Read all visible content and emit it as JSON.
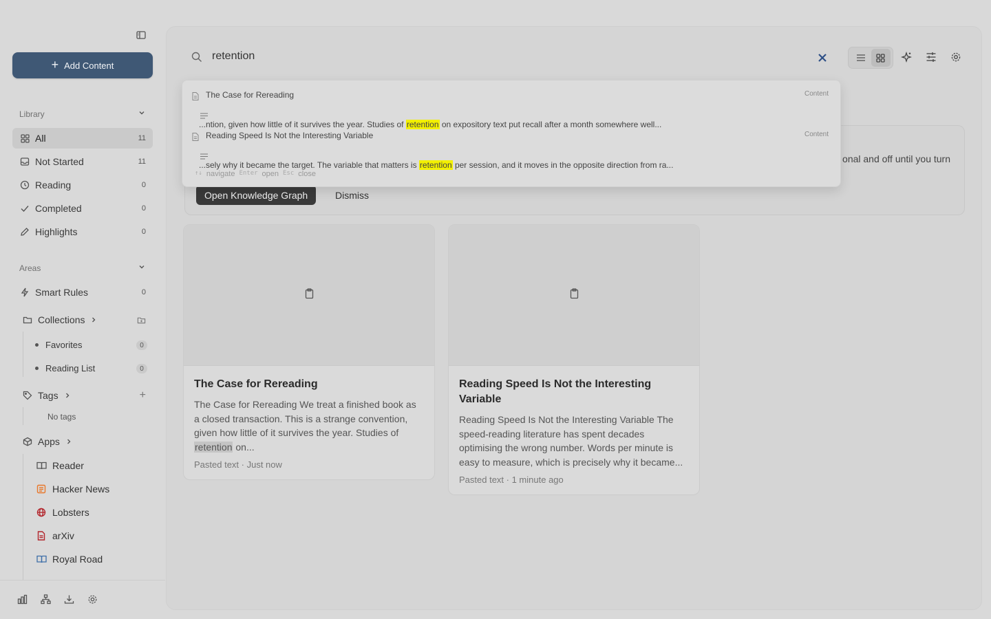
{
  "sidebar": {
    "add_label": "Add Content",
    "library_label": "Library",
    "library": [
      {
        "label": "All",
        "count": "11"
      },
      {
        "label": "Not Started",
        "count": "11"
      },
      {
        "label": "Reading",
        "count": "0"
      },
      {
        "label": "Completed",
        "count": "0"
      },
      {
        "label": "Highlights",
        "count": "0"
      }
    ],
    "areas_label": "Areas",
    "smart_rules": {
      "label": "Smart Rules",
      "count": "0"
    },
    "collections_label": "Collections",
    "collections": [
      {
        "label": "Favorites",
        "count": "0"
      },
      {
        "label": "Reading List",
        "count": "0"
      }
    ],
    "tags_label": "Tags",
    "no_tags": "No tags",
    "apps_label": "Apps",
    "apps": [
      {
        "label": "Reader",
        "icon": "book-icon",
        "color": "#555555"
      },
      {
        "label": "Hacker News",
        "icon": "hacker-news-icon",
        "color": "#e8772a"
      },
      {
        "label": "Lobsters",
        "icon": "globe-icon",
        "color": "#b3262d"
      },
      {
        "label": "arXiv",
        "icon": "document-icon",
        "color": "#b3262d"
      },
      {
        "label": "Royal Road",
        "icon": "book-open-icon",
        "color": "#3d6ea8"
      }
    ]
  },
  "search": {
    "value": "retention"
  },
  "dropdown": {
    "results": [
      {
        "title": "The Case for Rereading",
        "badge": "Content",
        "snippet_pre": "...ntion, given how little of it survives the year. Studies of ",
        "snippet_hl": "retention",
        "snippet_post": " on expository text put recall after a month somewhere well..."
      },
      {
        "title": "Reading Speed Is Not the Interesting Variable",
        "badge": "Content",
        "snippet_pre": "...sely why it became the target. The variable that matters is ",
        "snippet_hl": "retention",
        "snippet_post": " per session, and it moves in the opposite direction from ra..."
      }
    ],
    "hint_keys": "↑↓",
    "hint_navigate": "navigate",
    "hint_enter": "Enter",
    "hint_open": "open",
    "hint_esc": "Esc",
    "hint_close": "close"
  },
  "banner": {
    "text_fragment": "onal and off until you turn",
    "primary_label": "Open Knowledge Graph",
    "dismiss_label": "Dismiss"
  },
  "cards": [
    {
      "title": "The Case for Rereading",
      "snippet_pre": "The Case for Rereading We treat a finished book as a closed transaction. This is a strange convention, given how little of it survives the year. Studies of ",
      "snippet_hl": "retention",
      "snippet_post": " on...",
      "meta": "Pasted text · Just now"
    },
    {
      "title": "Reading Speed Is Not the Interesting Variable",
      "snippet_pre": "Reading Speed Is Not the Interesting Variable The speed-reading literature has spent decades optimising the wrong number. Words per minute is easy to measure, which is precisely why it became...",
      "snippet_hl": "",
      "snippet_post": "",
      "meta": "Pasted text · 1 minute ago"
    }
  ],
  "colors": {
    "accent": "#3f5875",
    "highlight": "#f3f000",
    "clear": "#2d4f86"
  }
}
